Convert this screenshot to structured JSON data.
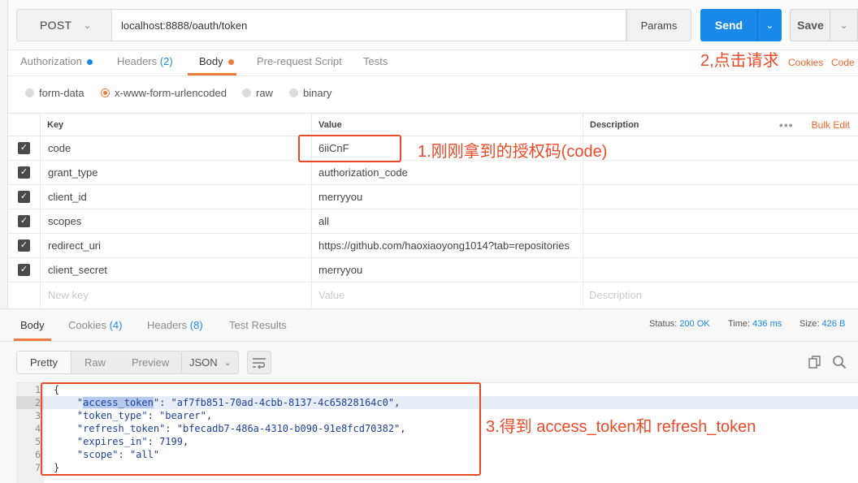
{
  "request": {
    "method": "POST",
    "url": "localhost:8888/oauth/token",
    "params_label": "Params",
    "send_label": "Send",
    "save_label": "Save"
  },
  "request_tabs": [
    {
      "label": "Authorization",
      "count": "",
      "dot": "blue"
    },
    {
      "label": "Headers",
      "count": "(2)",
      "dot": ""
    },
    {
      "label": "Body",
      "count": "",
      "dot": "orange"
    },
    {
      "label": "Pre-request Script",
      "count": "",
      "dot": ""
    },
    {
      "label": "Tests",
      "count": "",
      "dot": ""
    }
  ],
  "links": {
    "cookies": "Cookies",
    "code": "Code",
    "bulk_edit": "Bulk Edit"
  },
  "body_modes": [
    "form-data",
    "x-www-form-urlencoded",
    "raw",
    "binary"
  ],
  "selected_body_mode": "x-www-form-urlencoded",
  "table": {
    "headers": {
      "key": "Key",
      "value": "Value",
      "description": "Description"
    },
    "rows": [
      {
        "key": "code",
        "value": "6iiCnF",
        "checked": true
      },
      {
        "key": "grant_type",
        "value": "authorization_code",
        "checked": true
      },
      {
        "key": "client_id",
        "value": "merryyou",
        "checked": true
      },
      {
        "key": "scopes",
        "value": "all",
        "checked": true
      },
      {
        "key": "redirect_uri",
        "value": "https://github.com/haoxiaoyong1014?tab=repositories",
        "checked": true
      },
      {
        "key": "client_secret",
        "value": "merryyou",
        "checked": true
      }
    ],
    "new_row": {
      "key": "New key",
      "value": "Value",
      "description": "Description"
    }
  },
  "response": {
    "tabs": [
      {
        "label": "Body",
        "count": ""
      },
      {
        "label": "Cookies",
        "count": "(4)"
      },
      {
        "label": "Headers",
        "count": "(8)"
      },
      {
        "label": "Test Results",
        "count": ""
      }
    ],
    "status_label": "Status:",
    "status_value": "200 OK",
    "time_label": "Time:",
    "time_value": "436 ms",
    "size_label": "Size:",
    "size_value": "426 B",
    "format_modes": [
      "Pretty",
      "Raw",
      "Preview"
    ],
    "format_type": "JSON",
    "line_numbers": [
      "1",
      "2",
      "3",
      "4",
      "5",
      "6",
      "7"
    ],
    "json": {
      "open": "{",
      "close": "}",
      "fields": [
        {
          "key": "access_token",
          "value": "\"af7fb851-70ad-4cbb-8137-4c65828164c0\"",
          "comma": ","
        },
        {
          "key": "token_type",
          "value": "\"bearer\"",
          "comma": ","
        },
        {
          "key": "refresh_token",
          "value": "\"bfecadb7-486a-4310-b090-91e8fcd70382\"",
          "comma": ","
        },
        {
          "key": "expires_in",
          "value": "7199",
          "comma": ","
        },
        {
          "key": "scope",
          "value": "\"all\"",
          "comma": ""
        }
      ]
    }
  },
  "annotations": {
    "step1": "1.刚刚拿到的授权码(code)",
    "step2": "2,点击请求",
    "step3": "3.得到 access_token和 refresh_token"
  },
  "colors": {
    "accent_orange": "#f07b3f",
    "send_blue": "#1a88e8",
    "annotation_red": "#e94a28"
  }
}
